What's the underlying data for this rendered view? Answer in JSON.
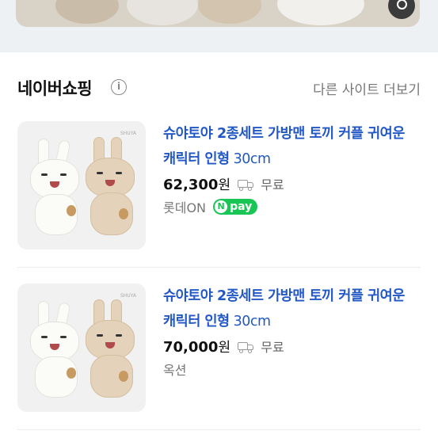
{
  "section": {
    "title": "네이버쇼핑",
    "info_icon": "i",
    "more_link": "다른 사이트 더보기"
  },
  "products": [
    {
      "title_bold": "슈야토야 2종세트 가방맨 토끼 커플 귀여운 캐릭터 인형",
      "title_rest": " 30cm",
      "price": "62,300",
      "currency": "원",
      "shipping": "무료",
      "seller": "롯데ON",
      "badge": "pay",
      "badge_n": "N"
    },
    {
      "title_bold": "슈야토야 2종세트 가방맨 토끼 커플 귀여운 캐릭터 인형",
      "title_rest": " 30cm",
      "price": "70,000",
      "currency": "원",
      "shipping": "무료",
      "seller": "옥션"
    }
  ],
  "colors": {
    "link_blue": "#2257c6",
    "npay_green": "#19c555"
  },
  "icons": [
    "search-lens-icon",
    "info-icon",
    "truck-icon",
    "npay-icon"
  ]
}
